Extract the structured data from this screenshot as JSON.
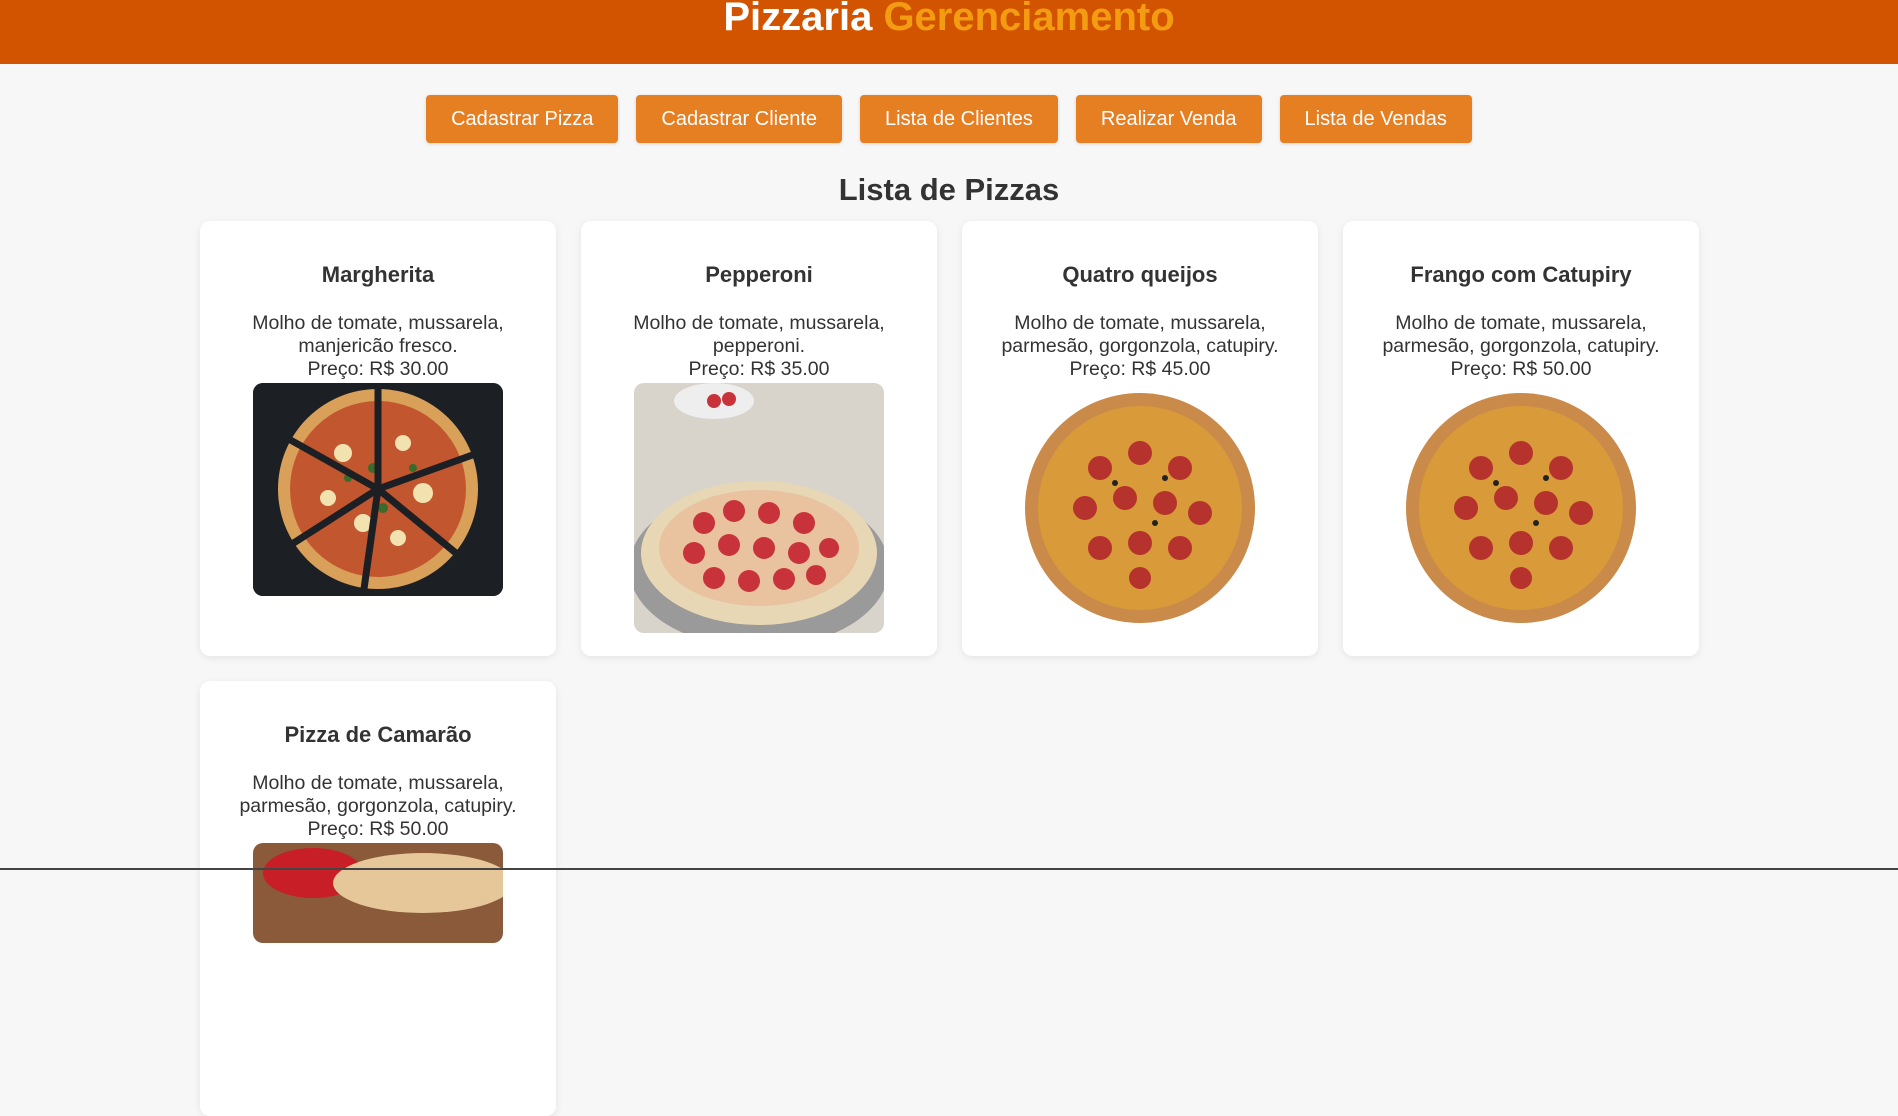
{
  "header": {
    "title_white": "Pizzaria",
    "title_orange": "Gerenciamento"
  },
  "nav": [
    {
      "label": "Cadastrar Pizza"
    },
    {
      "label": "Cadastrar Cliente"
    },
    {
      "label": "Lista de Clientes"
    },
    {
      "label": "Realizar Venda"
    },
    {
      "label": "Lista de Vendas"
    }
  ],
  "section_title": "Lista de Pizzas",
  "pizzas": [
    {
      "name": "Margherita",
      "desc": "Molho de tomate, mussarela, manjericão fresco.",
      "price": "Preço: R$ 30.00",
      "image": "sliced-pizza-dark-board"
    },
    {
      "name": "Pepperoni",
      "desc": "Molho de tomate, mussarela, pepperoni.",
      "price": "Preço: R$ 35.00",
      "image": "sausage-pizza-tray"
    },
    {
      "name": "Quatro queijos",
      "desc": "Molho de tomate, mussarela, parmesão, gorgonzola, catupiry.",
      "price": "Preço: R$ 45.00",
      "image": "calabresa-pizza-white"
    },
    {
      "name": "Frango com Catupiry",
      "desc": "Molho de tomate, mussarela, parmesão, gorgonzola, catupiry.",
      "price": "Preço: R$ 50.00",
      "image": "calabresa-pizza-white"
    },
    {
      "name": "Pizza de Camarão",
      "desc": "Molho de tomate, mussarela, parmesão, gorgonzola, catupiry.",
      "price": "Preço: R$ 50.00",
      "image": "shrimp-pizza-partial"
    }
  ],
  "colors": {
    "header": "#d35400",
    "accent": "#e67e22",
    "accent_text": "#f39c12"
  }
}
